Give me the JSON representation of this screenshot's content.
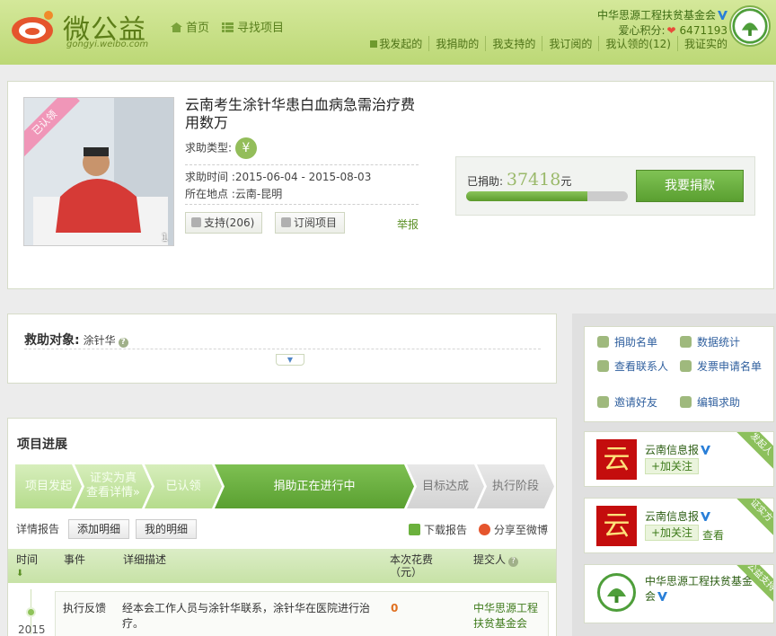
{
  "header": {
    "logo_text": "微公益",
    "logo_sub": "gongyi.weibo.com",
    "nav_home": "首页",
    "nav_find": "寻找项目",
    "org_name": "中华思源工程扶贫基金会",
    "points_label": "爱心积分:",
    "points_value": "6471193",
    "menu": [
      "我发起的",
      "我捐助的",
      "我支持的",
      "我订阅的",
      "我认领的(12)",
      "我证实的"
    ]
  },
  "project": {
    "badge": "已认领",
    "photo_index": "1",
    "title": "云南考生涂针华患白血病急需治疗费用数万",
    "type_label": "求助类型:",
    "time_label": "求助时间",
    "time_value": ":2015-06-04 - 2015-08-03",
    "place_label": "所在地点",
    "place_value": ":云南-昆明",
    "support_label": "支持(206)",
    "subscribe_label": "订阅项目",
    "report_label": "举报",
    "donated_label": "已捐助:",
    "donated_value": "37418",
    "donated_unit": "元",
    "progress": 0.75,
    "donate_button": "我要捐款"
  },
  "target": {
    "label": "救助对象:",
    "name": "涂针华"
  },
  "progress_section": {
    "title": "项目进展",
    "steps": [
      {
        "label": "项目发起",
        "state": "done"
      },
      {
        "label": "证实为真",
        "label2": "查看详情»",
        "state": "done"
      },
      {
        "label": "已认领",
        "state": "done"
      },
      {
        "label": "捐助正在进行中",
        "state": "current"
      },
      {
        "label": "目标达成",
        "state": "todo"
      },
      {
        "label": "执行阶段",
        "state": "todo"
      }
    ],
    "details_label": "详情报告",
    "add_detail": "添加明细",
    "my_detail": "我的明细",
    "download": "下载报告",
    "share": "分享至微博",
    "columns": [
      "时间",
      "事件",
      "详细描述",
      "本次花费",
      "（元）",
      "提交人"
    ],
    "row": {
      "year": "2015",
      "event": "执行反馈",
      "desc": "经本会工作人员与涂针华联系，涂针华在医院进行治疗。",
      "cost": "0",
      "submitter": "中华思源工程扶贫基金会"
    }
  },
  "side_links": {
    "donor_list": "捐助名单",
    "stats": "数据统计",
    "contacts": "查看联系人",
    "invoice": "发票申请名单",
    "invite": "邀请好友",
    "edit": "编辑求助"
  },
  "cards": [
    {
      "name": "云南信息报",
      "follow": "+加关注",
      "corner": "发起人",
      "logo": "云"
    },
    {
      "name": "云南信息报",
      "follow": "+加关注",
      "view": "查看",
      "corner": "证实方",
      "logo": "云"
    },
    {
      "name": "中华思源工程扶贫基金会",
      "corner": "公益支持"
    }
  ],
  "colors": {
    "brand_green": "#5a9f30",
    "heart": "#e84b3a",
    "cost": "#e07020"
  }
}
